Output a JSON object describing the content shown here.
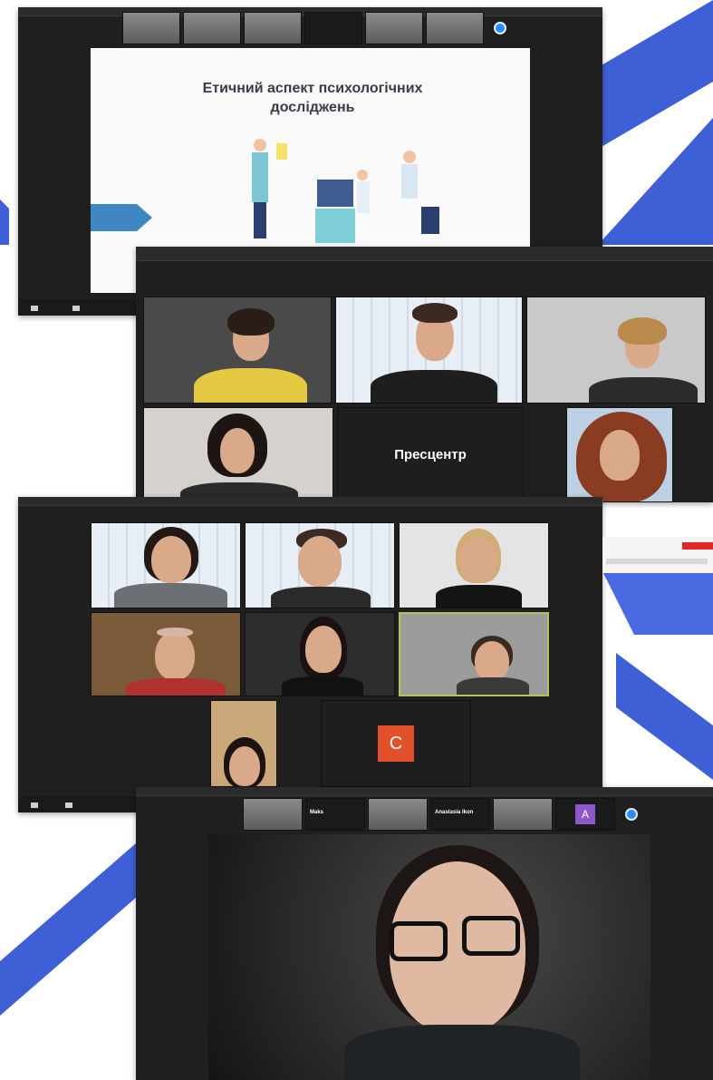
{
  "slide": {
    "title_line1": "Етичний аспект психологічних",
    "title_line2": "досліджень"
  },
  "window2": {
    "center_label": "Пресцентр"
  },
  "window3": {
    "letter_avatar": "C"
  },
  "window4": {
    "letter_avatar": "A",
    "strip_label_1": "Maks",
    "strip_label_2": "Anastasia Ikon"
  },
  "colors": {
    "stripe_blue": "#3f5fd6",
    "zoom_dark": "#1f1f1f",
    "slide_arrow": "#3f87c2",
    "avatar_orange": "#e0512c",
    "avatar_purple": "#8e57c9",
    "leave_red": "#e02828"
  }
}
